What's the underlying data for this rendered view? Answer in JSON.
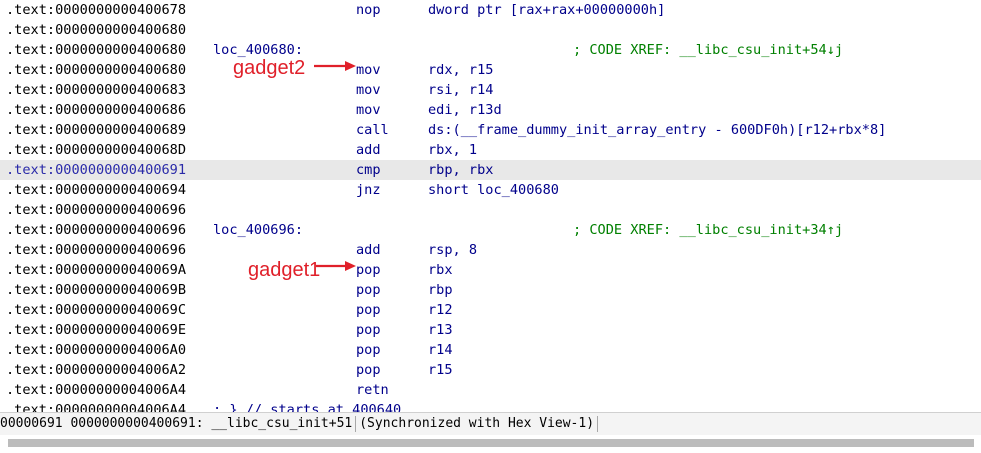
{
  "disasm": {
    "lines": [
      {
        "addr": ".text:0000000000400678",
        "label": "",
        "mnem": "nop",
        "ops": "dword ptr [rax+rax+00000000h]",
        "xref": "",
        "hl": false
      },
      {
        "addr": ".text:0000000000400680",
        "label": "",
        "mnem": "",
        "ops": "",
        "xref": "",
        "hl": false
      },
      {
        "addr": ".text:0000000000400680",
        "label": "loc_400680:",
        "mnem": "",
        "ops": "",
        "xref": "; CODE XREF: __libc_csu_init+54↓j",
        "hl": false
      },
      {
        "addr": ".text:0000000000400680",
        "label": "",
        "mnem": "mov",
        "ops": "rdx, r15",
        "xref": "",
        "hl": false
      },
      {
        "addr": ".text:0000000000400683",
        "label": "",
        "mnem": "mov",
        "ops": "rsi, r14",
        "xref": "",
        "hl": false
      },
      {
        "addr": ".text:0000000000400686",
        "label": "",
        "mnem": "mov",
        "ops": "edi, r13d",
        "xref": "",
        "hl": false
      },
      {
        "addr": ".text:0000000000400689",
        "label": "",
        "mnem": "call",
        "ops": "ds:(__frame_dummy_init_array_entry - 600DF0h)[r12+rbx*8]",
        "xref": "",
        "hl": false
      },
      {
        "addr": ".text:000000000040068D",
        "label": "",
        "mnem": "add",
        "ops": "rbx, 1",
        "xref": "",
        "hl": false
      },
      {
        "addr": ".text:0000000000400691",
        "label": "",
        "mnem": "cmp",
        "ops": "rbp, rbx",
        "xref": "",
        "hl": true
      },
      {
        "addr": ".text:0000000000400694",
        "label": "",
        "mnem": "jnz",
        "ops": "short loc_400680",
        "xref": "",
        "hl": false
      },
      {
        "addr": ".text:0000000000400696",
        "label": "",
        "mnem": "",
        "ops": "",
        "xref": "",
        "hl": false
      },
      {
        "addr": ".text:0000000000400696",
        "label": "loc_400696:",
        "mnem": "",
        "ops": "",
        "xref": "; CODE XREF: __libc_csu_init+34↑j",
        "hl": false
      },
      {
        "addr": ".text:0000000000400696",
        "label": "",
        "mnem": "add",
        "ops": "rsp, 8",
        "xref": "",
        "hl": false
      },
      {
        "addr": ".text:000000000040069A",
        "label": "",
        "mnem": "pop",
        "ops": "rbx",
        "xref": "",
        "hl": false
      },
      {
        "addr": ".text:000000000040069B",
        "label": "",
        "mnem": "pop",
        "ops": "rbp",
        "xref": "",
        "hl": false
      },
      {
        "addr": ".text:000000000040069C",
        "label": "",
        "mnem": "pop",
        "ops": "r12",
        "xref": "",
        "hl": false
      },
      {
        "addr": ".text:000000000040069E",
        "label": "",
        "mnem": "pop",
        "ops": "r13",
        "xref": "",
        "hl": false
      },
      {
        "addr": ".text:00000000004006A0",
        "label": "",
        "mnem": "pop",
        "ops": "r14",
        "xref": "",
        "hl": false
      },
      {
        "addr": ".text:00000000004006A2",
        "label": "",
        "mnem": "pop",
        "ops": "r15",
        "xref": "",
        "hl": false
      },
      {
        "addr": ".text:00000000004006A4",
        "label": "",
        "mnem": "retn",
        "ops": "",
        "xref": "",
        "hl": false
      }
    ],
    "last_line": {
      "addr": ".text:00000000004006A4",
      "comment": "; } // starts at 400640"
    }
  },
  "annotations": {
    "gadget2": "gadget2",
    "gadget1": "gadget1",
    "color": "#e0202a"
  },
  "status": {
    "offset": "00000691",
    "address": "0000000000400691",
    "location": "__libc_csu_init+51",
    "sync": "(Synchronized with Hex View-1)"
  },
  "colors": {
    "mnemonic": "#00008b",
    "xref": "#008000",
    "highlight_row": "#e8e8e8"
  }
}
